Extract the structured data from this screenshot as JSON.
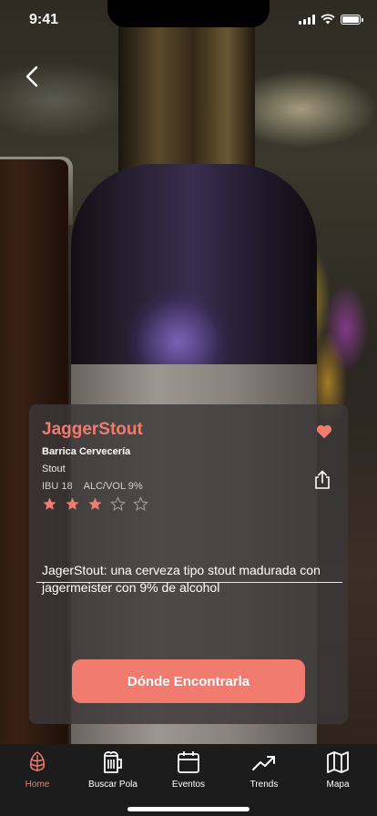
{
  "status_bar": {
    "time": "9:41"
  },
  "colors": {
    "accent": "#f07b6e",
    "card_bg": "#3c3838",
    "tab_bar_bg": "#1d1c1c"
  },
  "beer": {
    "name": "JaggerStout",
    "brewery": "Barrica Cervecería",
    "style": "Stout",
    "ibu": "IBU 18",
    "abv": "ALC/VOL 9%",
    "rating": 3,
    "rating_max": 5,
    "favorite": true,
    "description": "JagerStout: una cerveza tipo stout madurada con jagermeister con 9% de alcohol"
  },
  "cta": {
    "label": "Dónde Encontrarla"
  },
  "tabs": [
    {
      "label": "Home",
      "icon": "hop-icon",
      "active": true
    },
    {
      "label": "Buscar Pola",
      "icon": "beer-mug-icon",
      "active": false
    },
    {
      "label": "Eventos",
      "icon": "calendar-icon",
      "active": false
    },
    {
      "label": "Trends",
      "icon": "trend-icon",
      "active": false
    },
    {
      "label": "Mapa",
      "icon": "map-icon",
      "active": false
    }
  ]
}
